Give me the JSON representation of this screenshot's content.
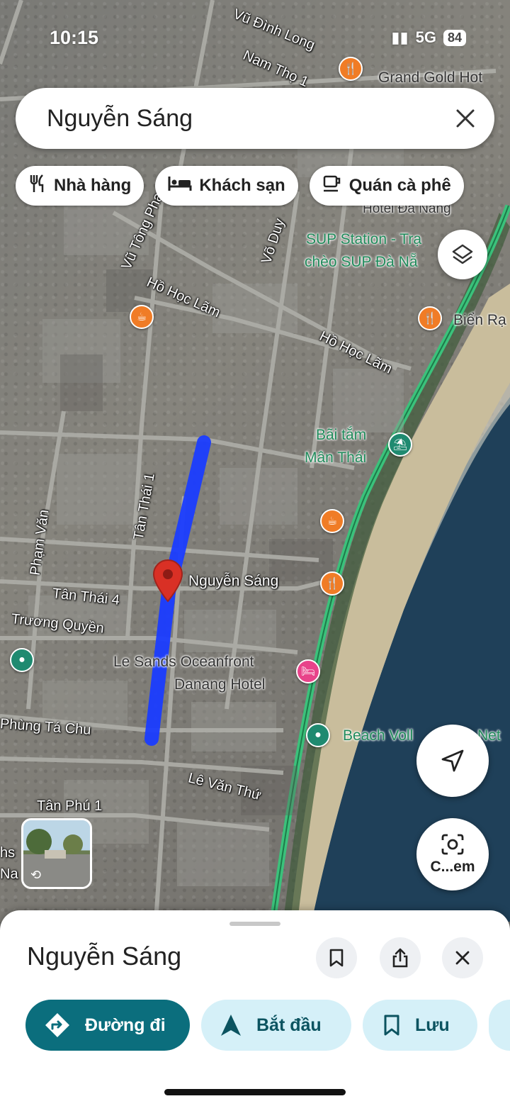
{
  "status": {
    "time": "10:15",
    "network": "5G",
    "battery": "84"
  },
  "search": {
    "query": "Nguyễn Sáng"
  },
  "chips": [
    {
      "label": "Nhà hàng",
      "icon": "restaurant-icon"
    },
    {
      "label": "Khách sạn",
      "icon": "hotel-icon"
    },
    {
      "label": "Quán cà phê",
      "icon": "coffee-icon"
    }
  ],
  "map": {
    "streets": {
      "nam_tho_1": "Nam Thọ 1",
      "vu_dinh_long": "Vũ Đình Long",
      "vu_tong_phan": "Vũ Tông Phan",
      "vo_duy": "Võ Duy",
      "ho_hoc_lam_1": "Hồ Học Lãm",
      "ho_hoc_lam_2": "Hồ Học Lãm",
      "tan_thai_1": "Tân Thái 1",
      "pham_van": "Phạm Văn",
      "nguyen_sang": "Nguyễn Sáng",
      "tan_thai_4": "Tân Thái 4",
      "truong_quyen": "Trương Quyền",
      "phung_ta_chu": "Phùng Tá Chu",
      "le_van_thu": "Lê Văn Thứ",
      "tan_phu_1": "Tân Phú 1",
      "hs": "hs",
      "na": "Na"
    },
    "pois": {
      "grand_gold": "Grand Gold Hot",
      "hotel_da_nang": "Hotel Đà Nẵng",
      "sup_station_1": "SUP Station - Trạ",
      "sup_station_2": "chèo SUP Đà Nẵ",
      "bien_ra": "Biển Rạ",
      "bai_tam_1": "Bãi tắm",
      "bai_tam_2": "Mân Thái",
      "le_sands_1": "Le Sands Oceanfront",
      "le_sands_2": "Danang Hotel",
      "beach_volley": "Beach Voll",
      "beach_volley_net": "Net"
    },
    "colors": {
      "route": "#1a3cff",
      "beach_road": "#39c07a",
      "sea": "#1d3e56",
      "sand": "#cbbf9f"
    }
  },
  "buttons": {
    "camera_label": "C...em"
  },
  "sheet": {
    "title": "Nguyễn Sáng",
    "actions": [
      {
        "label": "Đường đi",
        "icon": "directions-icon",
        "primary": true
      },
      {
        "label": "Bắt đầu",
        "icon": "navigation-icon",
        "primary": false
      },
      {
        "label": "Lưu",
        "icon": "bookmark-icon",
        "primary": false
      }
    ]
  },
  "accent": "#0b6e7d",
  "secondary_bg": "#d5f0f8"
}
